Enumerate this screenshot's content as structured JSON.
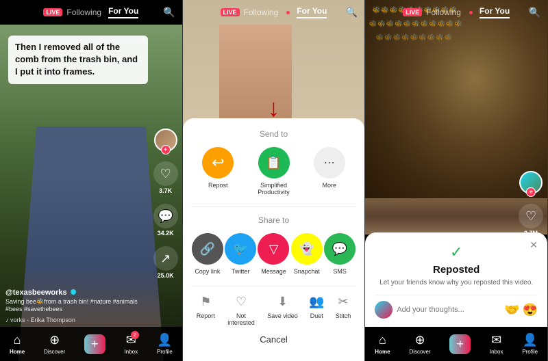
{
  "panels": [
    {
      "id": "panel-1",
      "topBar": {
        "live": "LIVE",
        "following": "Following",
        "forYou": "For You"
      },
      "caption": "Then I removed all of the comb from the trash bin, and I put it into frames.",
      "actions": {
        "likes": "3.7K",
        "comments": "34.2K",
        "shares": "25.0K"
      },
      "username": "@texasbeeworks",
      "description": "Saving bee🐝from a trash bin! #nature #animals #bees #savethebees",
      "sound": "♪ vorks - Erika Thompson",
      "nav": {
        "home": "Home",
        "discover": "Discover",
        "add": "+",
        "inbox": "Inbox",
        "profile": "Profile",
        "inboxBadge": "2"
      }
    },
    {
      "id": "panel-2",
      "topBar": {
        "live": "LIVE",
        "following": "Following",
        "forYou": "For You"
      },
      "share": {
        "sendTo": "Send to",
        "shareToItems": [
          {
            "label": "Repost",
            "color": "#ff9f00",
            "icon": "↩"
          },
          {
            "label": "Simplified Productivity",
            "color": "#1db954",
            "icon": "📋"
          },
          {
            "label": "More",
            "color": "#eee",
            "icon": "⋯"
          }
        ],
        "shareTo": "Share to",
        "shareItems": [
          {
            "label": "Copy link",
            "color": "#444",
            "icon": "🔗"
          },
          {
            "label": "Twitter",
            "color": "#1da1f2",
            "icon": "🐦"
          },
          {
            "label": "Message",
            "color": "#ee1d52",
            "icon": "✉"
          },
          {
            "label": "Snapchat",
            "color": "#fffc00",
            "icon": "👻"
          },
          {
            "label": "SMS",
            "color": "#2ab756",
            "icon": "💬"
          }
        ],
        "bottomActions": [
          {
            "label": "Report",
            "icon": "⚑"
          },
          {
            "label": "Not interested",
            "icon": "♡"
          },
          {
            "label": "Save video",
            "icon": "⬇"
          },
          {
            "label": "Duet",
            "icon": "👥"
          },
          {
            "label": "Stitch",
            "icon": "✂"
          }
        ],
        "cancel": "Cancel"
      }
    },
    {
      "id": "panel-3",
      "topBar": {
        "live": "LIVE",
        "following": "Following",
        "forYou": "For You"
      },
      "repost": {
        "close": "✕",
        "checkmark": "✓",
        "title": "Reposted",
        "description": "Let your friends know why you reposted this video.",
        "inputPlaceholder": "Add your thoughts...",
        "emojis": [
          "🤝",
          "😍"
        ]
      }
    }
  ]
}
